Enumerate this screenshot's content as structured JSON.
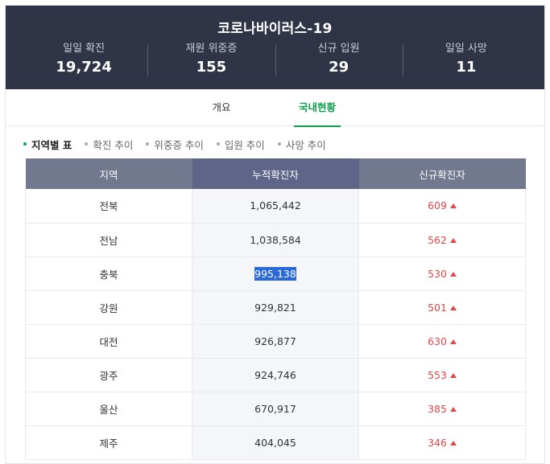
{
  "header": {
    "title": "코로나바이러스-19",
    "stats": [
      {
        "label": "일일 확진",
        "value": "19,724"
      },
      {
        "label": "재원 위중증",
        "value": "155"
      },
      {
        "label": "신규 입원",
        "value": "29"
      },
      {
        "label": "일일 사망",
        "value": "11"
      }
    ]
  },
  "tabs": [
    "개요",
    "국내현황"
  ],
  "subnav": [
    "지역별 표",
    "확진 추이",
    "위중증 추이",
    "입원 추이",
    "사망 추이"
  ],
  "table": {
    "headers": [
      "지역",
      "누적확진자",
      "신규확진자"
    ],
    "rows": [
      {
        "region": "전북",
        "total": "1,065,442",
        "new": "609"
      },
      {
        "region": "전남",
        "total": "1,038,584",
        "new": "562"
      },
      {
        "region": "충북",
        "total": "995,138",
        "new": "530"
      },
      {
        "region": "강원",
        "total": "929,821",
        "new": "501"
      },
      {
        "region": "대전",
        "total": "926,877",
        "new": "630"
      },
      {
        "region": "광주",
        "total": "924,746",
        "new": "553"
      },
      {
        "region": "울산",
        "total": "670,917",
        "new": "385"
      },
      {
        "region": "제주",
        "total": "404,045",
        "new": "346"
      }
    ]
  },
  "colors": {
    "header_bg": "#2f3547",
    "accent": "#0e9f4a",
    "increase": "#e04848",
    "selection": "#2a6ad8"
  }
}
